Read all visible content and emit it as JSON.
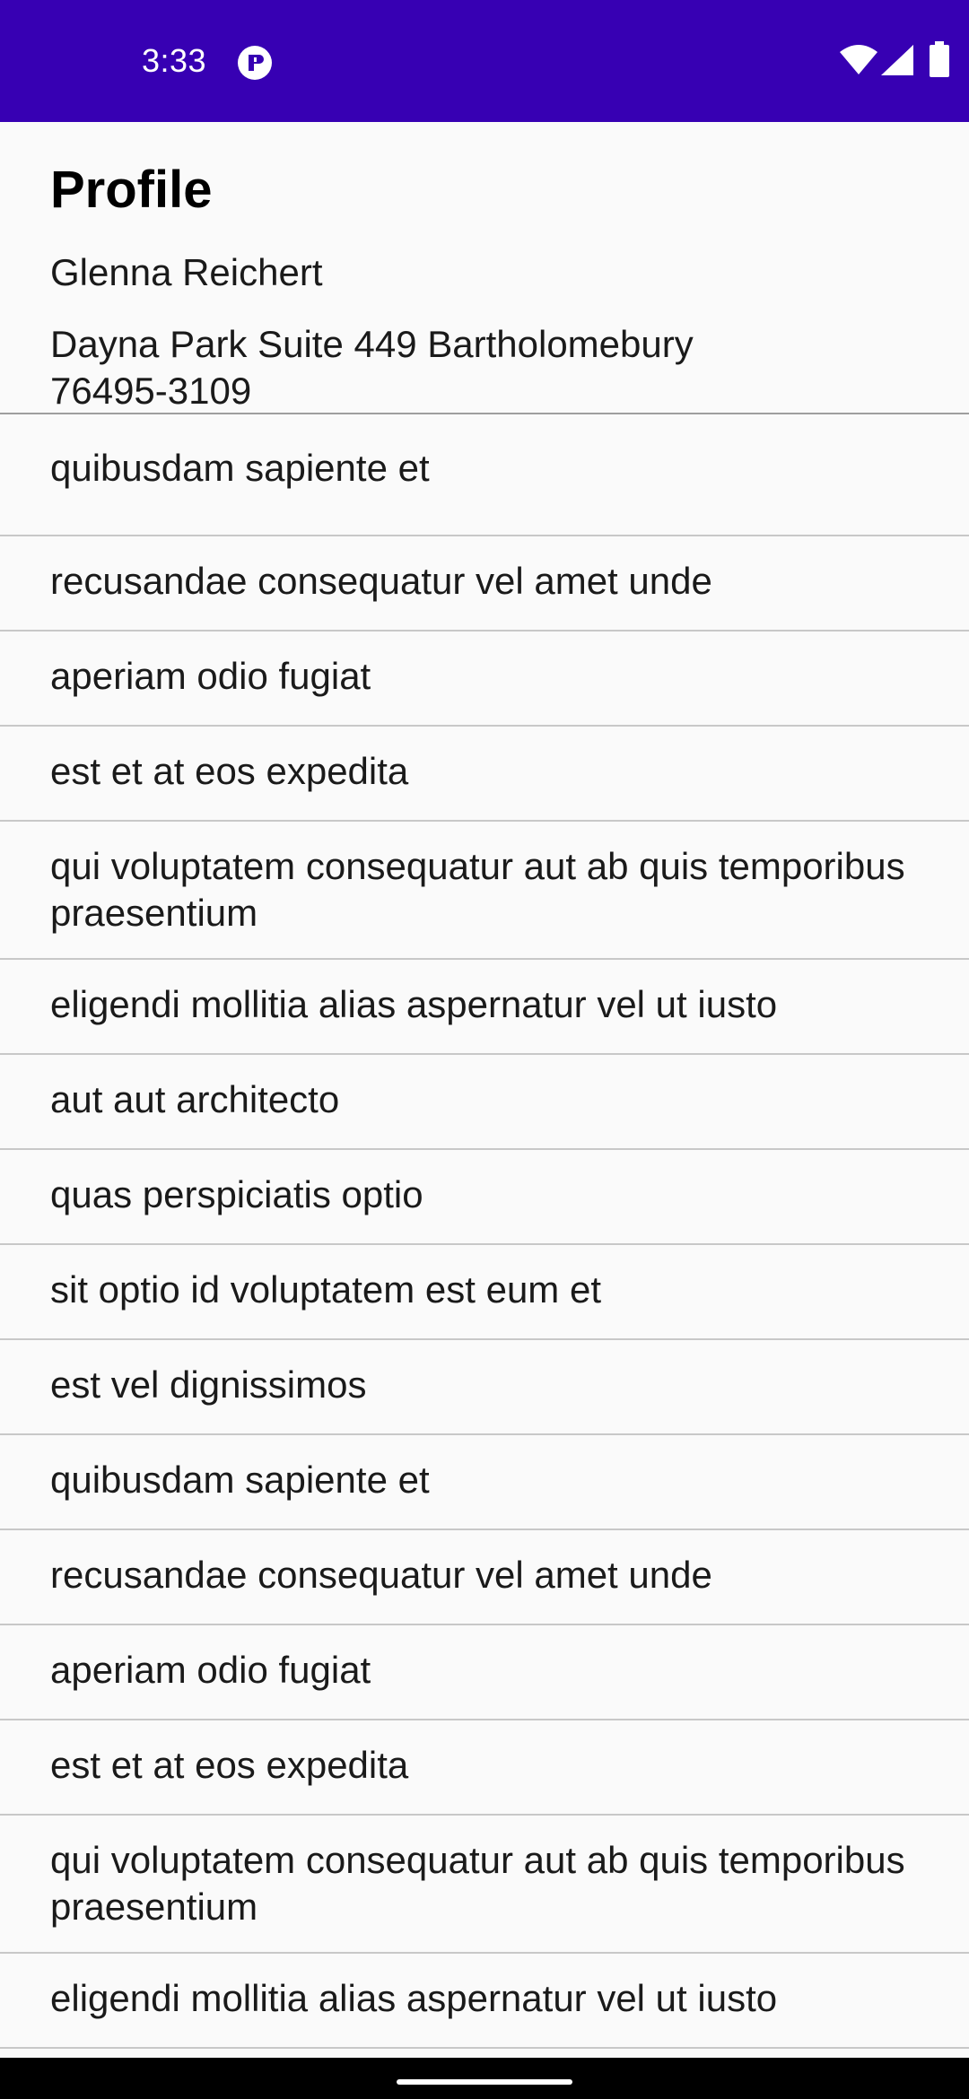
{
  "status_bar": {
    "time": "3:33",
    "icons": [
      "notification-icon",
      "wifi-icon",
      "signal-icon",
      "battery-icon"
    ],
    "background": "#3700b3"
  },
  "profile": {
    "title": "Profile",
    "name": "Glenna Reichert",
    "address": "Dayna Park Suite 449 Bartholomebury 76495-3109"
  },
  "items": [
    "quibusdam sapiente et",
    "recusandae consequatur vel amet unde",
    "aperiam odio fugiat",
    "est et at eos expedita",
    "qui voluptatem consequatur aut ab quis temporibus praesentium",
    "eligendi mollitia alias aspernatur vel ut iusto",
    "aut aut architecto",
    "quas perspiciatis optio",
    "sit optio id voluptatem est eum et",
    "est vel dignissimos",
    "quibusdam sapiente et",
    "recusandae consequatur vel amet unde",
    "aperiam odio fugiat",
    "est et at eos expedita",
    "qui voluptatem consequatur aut ab quis temporibus praesentium",
    "eligendi mollitia alias aspernatur vel ut iusto"
  ]
}
